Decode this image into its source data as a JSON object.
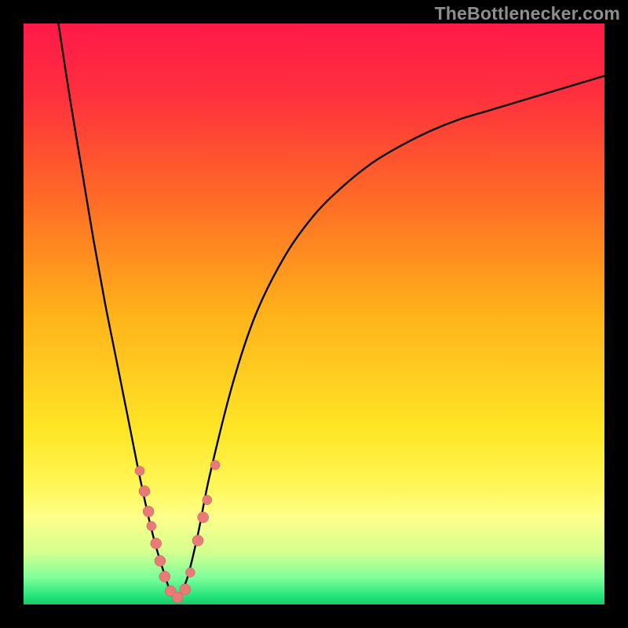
{
  "watermark": "TheBottlenecker.com",
  "colors": {
    "gradient_stops": [
      {
        "offset": 0.0,
        "color": "#ff1a49"
      },
      {
        "offset": 0.12,
        "color": "#ff2f3e"
      },
      {
        "offset": 0.3,
        "color": "#ff6a26"
      },
      {
        "offset": 0.5,
        "color": "#ffb21a"
      },
      {
        "offset": 0.7,
        "color": "#ffe626"
      },
      {
        "offset": 0.8,
        "color": "#fff75a"
      },
      {
        "offset": 0.85,
        "color": "#fdff8a"
      },
      {
        "offset": 0.91,
        "color": "#d4ff8f"
      },
      {
        "offset": 0.955,
        "color": "#7bff9a"
      },
      {
        "offset": 0.985,
        "color": "#27e57a"
      },
      {
        "offset": 1.0,
        "color": "#19c96b"
      }
    ],
    "curve": "#000000",
    "marker_fill": "#e87a78",
    "marker_stroke": "#c95a58",
    "frame": "#000000"
  },
  "chart_data": {
    "type": "line",
    "title": "",
    "xlabel": "",
    "ylabel": "",
    "xlim": [
      0,
      100
    ],
    "ylim": [
      0,
      100
    ],
    "series": [
      {
        "name": "bottleneck-curve",
        "x": [
          6,
          8,
          10,
          12,
          14,
          16,
          18,
          20,
          22,
          24,
          26,
          28,
          30,
          32,
          36,
          40,
          45,
          50,
          55,
          60,
          65,
          70,
          75,
          80,
          85,
          90,
          95,
          100
        ],
        "y": [
          100,
          87,
          75,
          63,
          52,
          42,
          32,
          22,
          13,
          6,
          1,
          4,
          12,
          22,
          38,
          50,
          60,
          67,
          72,
          76,
          79,
          81.5,
          83.5,
          85,
          86.5,
          88,
          89.5,
          91
        ]
      }
    ],
    "markers": {
      "name": "data-points",
      "points": [
        {
          "x": 20.0,
          "y": 23.0,
          "r": 6
        },
        {
          "x": 20.8,
          "y": 19.5,
          "r": 7
        },
        {
          "x": 21.5,
          "y": 16.0,
          "r": 7
        },
        {
          "x": 22.0,
          "y": 13.5,
          "r": 6
        },
        {
          "x": 22.8,
          "y": 10.5,
          "r": 7
        },
        {
          "x": 23.5,
          "y": 7.5,
          "r": 7
        },
        {
          "x": 24.3,
          "y": 4.8,
          "r": 7
        },
        {
          "x": 25.3,
          "y": 2.3,
          "r": 7
        },
        {
          "x": 26.5,
          "y": 1.2,
          "r": 7
        },
        {
          "x": 27.8,
          "y": 2.6,
          "r": 7
        },
        {
          "x": 28.7,
          "y": 5.5,
          "r": 6
        },
        {
          "x": 30.0,
          "y": 11.0,
          "r": 7
        },
        {
          "x": 30.9,
          "y": 15.0,
          "r": 7
        },
        {
          "x": 31.6,
          "y": 18.0,
          "r": 6
        },
        {
          "x": 33.0,
          "y": 24.0,
          "r": 6
        }
      ]
    },
    "optimum_x": 26
  }
}
